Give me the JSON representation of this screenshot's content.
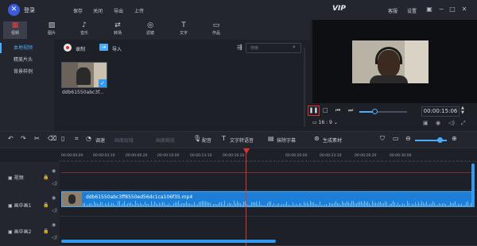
{
  "titlebar": {
    "login": "登录",
    "menus": [
      "保存",
      "关闭",
      "导出",
      "上传"
    ],
    "vip": "VIP",
    "help": "客服",
    "settings": "设置"
  },
  "tabs": [
    {
      "label": "视频",
      "icon": "film-icon",
      "glyph": "▦",
      "active": true
    },
    {
      "label": "图片",
      "icon": "image-icon",
      "glyph": "▨",
      "active": false
    },
    {
      "label": "音乐",
      "icon": "music-icon",
      "glyph": "♪",
      "active": false
    },
    {
      "label": "转场",
      "icon": "transition-icon",
      "glyph": "⇄",
      "active": false
    },
    {
      "label": "滤镜",
      "icon": "filter-icon",
      "glyph": "◎",
      "active": false
    },
    {
      "label": "文字",
      "icon": "text-icon",
      "glyph": "T",
      "active": false
    },
    {
      "label": "作品",
      "icon": "works-icon",
      "glyph": "▭",
      "active": false
    }
  ],
  "leftnav": [
    "本地视频",
    "精美片头",
    "背景样例"
  ],
  "media": {
    "record_label": "录制",
    "import_label": "导入",
    "search_placeholder": "搜索",
    "clip_name": "ddb61550abc3f..."
  },
  "player": {
    "time": "00:00:15:06",
    "aspect_ratio": "16 : 9",
    "volume_level": 0.33
  },
  "edit_toolbar": {
    "speed": "调速",
    "pip_layout": "画面层级",
    "crop_zoom": "画面缩放",
    "dub": "配音",
    "text_to_speech": "文字转语音",
    "subtitle_remove": "抹除字幕",
    "generate_material": "生成素材"
  },
  "ruler": [
    "00:00:00:00",
    "00:00:03:10",
    "00:00:06:20",
    "00:00:10:00",
    "00:00:13:10",
    "00:00:16:20",
    "00:00:20:00",
    "00:00:23:10",
    "00:00:26:20",
    "00:00:30:00"
  ],
  "tracks": [
    "视频",
    "画中画1",
    "画中画2"
  ],
  "clip": {
    "name": "ddb61550abc3ff8550ed56dc1ca106f35.mp4"
  },
  "colors": {
    "accent": "#339af0",
    "playhead": "#e03131",
    "background": "#1d2027"
  }
}
